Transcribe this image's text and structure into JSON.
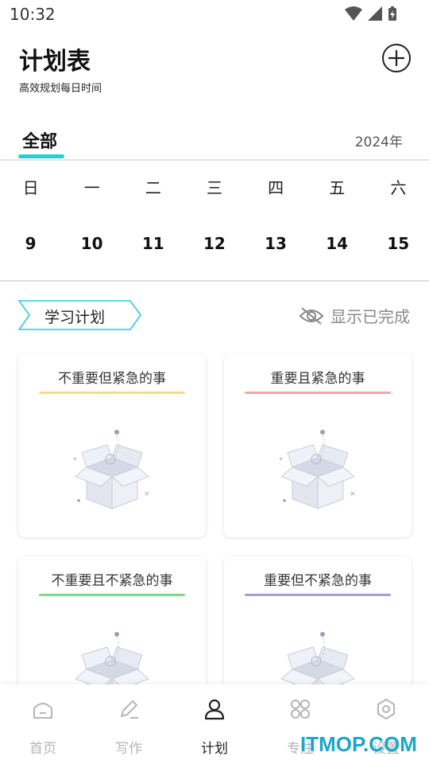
{
  "status_bar": {
    "time": "10:32"
  },
  "header": {
    "title": "计划表",
    "subtitle": "高效规划每日时间",
    "add_icon": "plus-circle-icon"
  },
  "tabs": {
    "active": "全部",
    "year": "2024年",
    "accent": "#2ec9d8"
  },
  "calendar": {
    "weekdays": [
      "日",
      "一",
      "二",
      "三",
      "四",
      "五",
      "六"
    ],
    "dates": [
      "9",
      "10",
      "11",
      "12",
      "13",
      "14",
      "15"
    ]
  },
  "plan_section": {
    "tag": "学习计划",
    "show_completed": "显示已完成",
    "show_completed_icon": "eye-off-icon"
  },
  "quadrants": [
    {
      "title": "不重要但紧急的事",
      "color": "#f2dc8a"
    },
    {
      "title": "重要且紧急的事",
      "color": "#f0a8a8"
    },
    {
      "title": "不重要且不紧急的事",
      "color": "#76dc8a"
    },
    {
      "title": "重要但不紧急的事",
      "color": "#a89ae0"
    }
  ],
  "bottom_nav": [
    {
      "label": "首页",
      "icon": "home-icon",
      "active": false
    },
    {
      "label": "写作",
      "icon": "edit-icon",
      "active": false
    },
    {
      "label": "计划",
      "icon": "person-icon",
      "active": true
    },
    {
      "label": "专注",
      "icon": "grid-icon",
      "active": false
    },
    {
      "label": "设置",
      "icon": "gear-icon",
      "active": false
    }
  ],
  "watermark": "ITMOP.COM"
}
